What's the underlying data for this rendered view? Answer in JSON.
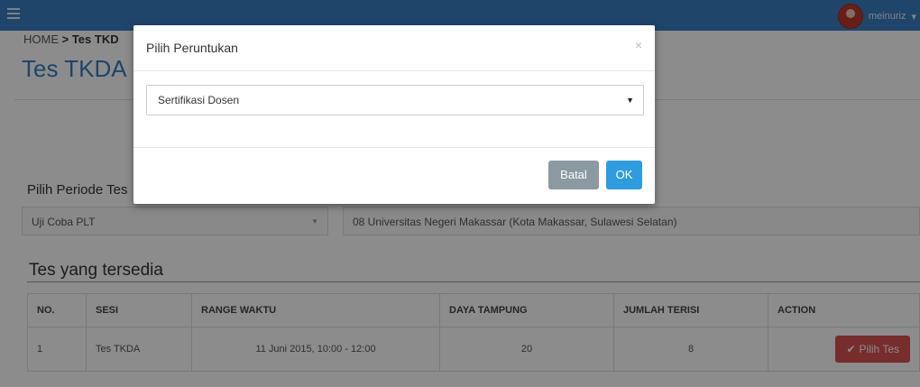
{
  "topbar": {
    "user_name": "meinuriz"
  },
  "breadcrumb": {
    "home": "HOME",
    "separator": " > ",
    "current": "Tes TKD"
  },
  "page": {
    "title": "Tes TKDA"
  },
  "form": {
    "periode_label": "Pilih Periode Tes",
    "periode_value": "Uji Coba PLT",
    "lokasi_value": "08 Universitas Negeri Makassar (Kota Makassar, Sulawesi Selatan)"
  },
  "section": {
    "title": "Tes yang tersedia"
  },
  "table": {
    "headers": [
      "NO.",
      "SESI",
      "RANGE WAKTU",
      "DAYA TAMPUNG",
      "JUMLAH TERISI",
      "ACTION"
    ],
    "rows": [
      {
        "no": "1",
        "sesi": "Tes TKDA",
        "range": "11 Juni 2015, 10:00 - 12:00",
        "daya": "20",
        "terisi": "8",
        "action": "Pilih Tes"
      }
    ]
  },
  "modal": {
    "title": "Pilih Peruntukan",
    "close": "×",
    "select_value": "Sertifikasi Dosen",
    "cancel_label": "Batal",
    "ok_label": "OK"
  },
  "colors": {
    "brand": "#3a7fc4",
    "danger": "#d9534f",
    "primary": "#2f9ce0",
    "muted": "#8a9aa0"
  }
}
